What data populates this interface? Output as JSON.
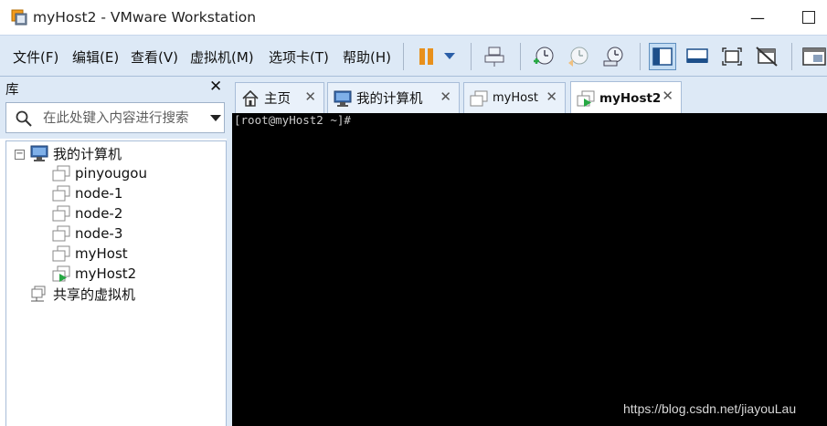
{
  "window": {
    "title": "myHost2 - VMware Workstation",
    "minimize": "—"
  },
  "menu": {
    "items": [
      "文件(F)",
      "编辑(E)",
      "查看(V)",
      "虚拟机(M)",
      "选项卡(T)",
      "帮助(H)"
    ]
  },
  "toolbar": {
    "icons": [
      "pause-icon",
      "dropdown-icon",
      "send-keys-icon",
      "snapshot-take-icon",
      "snapshot-revert-icon",
      "snapshot-manager-icon",
      "library-view-icon",
      "console-view-icon",
      "fullscreen-icon",
      "unity-icon",
      "thumbnail-bar-icon"
    ]
  },
  "library": {
    "title": "库",
    "close": "✕",
    "search_placeholder": "在此处键入内容进行搜索",
    "tree": {
      "root": "我的计算机",
      "expander": "−",
      "children": [
        "pinyougou",
        "node-1",
        "node-2",
        "node-3",
        "myHost",
        "myHost2"
      ],
      "shared": "共享的虚拟机"
    }
  },
  "tabs": [
    {
      "label": "主页",
      "icon": "home-icon",
      "close": "✕"
    },
    {
      "label": "我的计算机",
      "icon": "computer-icon",
      "close": "✕"
    },
    {
      "label": "myHost",
      "icon": "vm-icon",
      "close": "✕"
    },
    {
      "label": "myHost2",
      "icon": "vm-running-icon",
      "close": "✕",
      "active": true
    }
  ],
  "console": {
    "text": "[root@myHost2 ~]#"
  },
  "watermark": "https://blog.csdn.net/jiayouLau",
  "colors": {
    "chrome": "#dde9f6",
    "console_bg": "#000000",
    "running_green": "#27a844",
    "pause_orange": "#e8901c"
  }
}
